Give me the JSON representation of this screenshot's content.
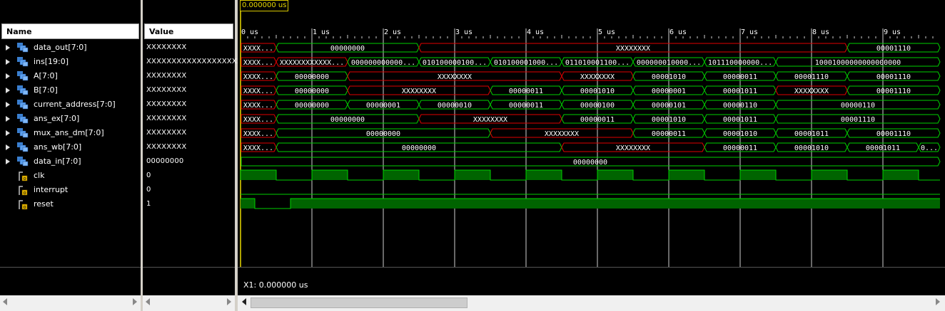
{
  "cursor_time": "0.000000 us",
  "headers": {
    "name": "Name",
    "value": "Value"
  },
  "time_ticks": [
    "0 us",
    "1 us",
    "2 us",
    "3 us",
    "4 us",
    "5 us",
    "6 us",
    "7 us",
    "8 us",
    "9 us"
  ],
  "cursor_readout": "X1: 0.000000 us",
  "colors": {
    "valid": "#00d000",
    "undefined": "#e00000",
    "cursor": "#e8d800",
    "clock_fill": "#006400"
  },
  "signals": [
    {
      "name": "data_out[7:0]",
      "value": "XXXXXXXX",
      "type": "bus",
      "segs": [
        {
          "t": 0,
          "e": 0.5,
          "v": "XXXXX...",
          "x": 1
        },
        {
          "t": 0.5,
          "e": 2.5,
          "v": "00000000",
          "x": 0
        },
        {
          "t": 2.5,
          "e": 8.5,
          "v": "XXXXXXXX",
          "x": 1
        },
        {
          "t": 8.5,
          "e": 9.8,
          "v": "00001110",
          "x": 0
        }
      ]
    },
    {
      "name": "ins[19:0]",
      "value": "XXXXXXXXXXXXXXXXXXXX",
      "type": "bus",
      "segs": [
        {
          "t": 0,
          "e": 0.5,
          "v": "XXXXX...",
          "x": 1
        },
        {
          "t": 0.5,
          "e": 1.5,
          "v": "XXXXXXXXXXXXX...",
          "x": 1
        },
        {
          "t": 1.5,
          "e": 2.5,
          "v": "0000000000000...",
          "x": 0
        },
        {
          "t": 2.5,
          "e": 3.5,
          "v": "0101000001000...",
          "x": 0
        },
        {
          "t": 3.5,
          "e": 4.5,
          "v": "0101000010000...",
          "x": 0
        },
        {
          "t": 4.5,
          "e": 5.5,
          "v": "0110100011000...",
          "x": 0
        },
        {
          "t": 5.5,
          "e": 6.5,
          "v": "0000000100000...",
          "x": 0
        },
        {
          "t": 6.5,
          "e": 7.5,
          "v": "1011100000001...",
          "x": 0
        },
        {
          "t": 7.5,
          "e": 9.8,
          "v": "10001000000000000000",
          "x": 0
        }
      ]
    },
    {
      "name": "A[7:0]",
      "value": "XXXXXXXX",
      "type": "bus",
      "segs": [
        {
          "t": 0,
          "e": 0.5,
          "v": "XXXXX...",
          "x": 1
        },
        {
          "t": 0.5,
          "e": 1.5,
          "v": "00000000",
          "x": 0
        },
        {
          "t": 1.5,
          "e": 4.5,
          "v": "XXXXXXXX",
          "x": 1
        },
        {
          "t": 4.5,
          "e": 5.5,
          "v": "XXXXXXXX",
          "x": 1
        },
        {
          "t": 5.5,
          "e": 6.5,
          "v": "00001010",
          "x": 0
        },
        {
          "t": 6.5,
          "e": 7.5,
          "v": "00000011",
          "x": 0
        },
        {
          "t": 7.5,
          "e": 8.5,
          "v": "00001110",
          "x": 0
        },
        {
          "t": 8.5,
          "e": 9.8,
          "v": "00001110",
          "x": 0
        }
      ]
    },
    {
      "name": "B[7:0]",
      "value": "XXXXXXXX",
      "type": "bus",
      "segs": [
        {
          "t": 0,
          "e": 0.5,
          "v": "XXXXX...",
          "x": 1
        },
        {
          "t": 0.5,
          "e": 1.5,
          "v": "00000000",
          "x": 0
        },
        {
          "t": 1.5,
          "e": 3.5,
          "v": "XXXXXXXX",
          "x": 1
        },
        {
          "t": 3.5,
          "e": 4.5,
          "v": "00000011",
          "x": 0
        },
        {
          "t": 4.5,
          "e": 5.5,
          "v": "00001010",
          "x": 0
        },
        {
          "t": 5.5,
          "e": 6.5,
          "v": "00000001",
          "x": 0
        },
        {
          "t": 6.5,
          "e": 7.5,
          "v": "00001011",
          "x": 0
        },
        {
          "t": 7.5,
          "e": 8.5,
          "v": "XXXXXXXX",
          "x": 1
        },
        {
          "t": 8.5,
          "e": 9.8,
          "v": "00001110",
          "x": 0
        }
      ]
    },
    {
      "name": "current_address[7:0]",
      "value": "XXXXXXXX",
      "type": "bus",
      "segs": [
        {
          "t": 0,
          "e": 0.5,
          "v": "XXXXX...",
          "x": 1
        },
        {
          "t": 0.5,
          "e": 1.5,
          "v": "00000000",
          "x": 0
        },
        {
          "t": 1.5,
          "e": 2.5,
          "v": "00000001",
          "x": 0
        },
        {
          "t": 2.5,
          "e": 3.5,
          "v": "00000010",
          "x": 0
        },
        {
          "t": 3.5,
          "e": 4.5,
          "v": "00000011",
          "x": 0
        },
        {
          "t": 4.5,
          "e": 5.5,
          "v": "00000100",
          "x": 0
        },
        {
          "t": 5.5,
          "e": 6.5,
          "v": "00000101",
          "x": 0
        },
        {
          "t": 6.5,
          "e": 7.5,
          "v": "00000110",
          "x": 0
        },
        {
          "t": 7.5,
          "e": 9.8,
          "v": "00000110",
          "x": 0
        }
      ]
    },
    {
      "name": "ans_ex[7:0]",
      "value": "XXXXXXXX",
      "type": "bus",
      "segs": [
        {
          "t": 0,
          "e": 0.5,
          "v": "XXXXX...",
          "x": 1
        },
        {
          "t": 0.5,
          "e": 2.5,
          "v": "00000000",
          "x": 0
        },
        {
          "t": 2.5,
          "e": 4.5,
          "v": "XXXXXXXX",
          "x": 1
        },
        {
          "t": 4.5,
          "e": 5.5,
          "v": "00000011",
          "x": 0
        },
        {
          "t": 5.5,
          "e": 6.5,
          "v": "00001010",
          "x": 0
        },
        {
          "t": 6.5,
          "e": 7.5,
          "v": "00001011",
          "x": 0
        },
        {
          "t": 7.5,
          "e": 9.8,
          "v": "00001110",
          "x": 0
        }
      ]
    },
    {
      "name": "mux_ans_dm[7:0]",
      "value": "XXXXXXXX",
      "type": "bus",
      "segs": [
        {
          "t": 0,
          "e": 0.5,
          "v": "XXXXX...",
          "x": 1
        },
        {
          "t": 0.5,
          "e": 3.5,
          "v": "00000000",
          "x": 0
        },
        {
          "t": 3.5,
          "e": 5.5,
          "v": "XXXXXXXX",
          "x": 1
        },
        {
          "t": 5.5,
          "e": 6.5,
          "v": "00000011",
          "x": 0
        },
        {
          "t": 6.5,
          "e": 7.5,
          "v": "00001010",
          "x": 0
        },
        {
          "t": 7.5,
          "e": 8.5,
          "v": "00001011",
          "x": 0
        },
        {
          "t": 8.5,
          "e": 9.8,
          "v": "00001110",
          "x": 0
        }
      ]
    },
    {
      "name": "ans_wb[7:0]",
      "value": "XXXXXXXX",
      "type": "bus",
      "segs": [
        {
          "t": 0,
          "e": 0.5,
          "v": "XXXXX...",
          "x": 1
        },
        {
          "t": 0.5,
          "e": 4.5,
          "v": "00000000",
          "x": 0
        },
        {
          "t": 4.5,
          "e": 6.5,
          "v": "XXXXXXXX",
          "x": 1
        },
        {
          "t": 6.5,
          "e": 7.5,
          "v": "00000011",
          "x": 0
        },
        {
          "t": 7.5,
          "e": 8.5,
          "v": "00001010",
          "x": 0
        },
        {
          "t": 8.5,
          "e": 9.5,
          "v": "00001011",
          "x": 0
        },
        {
          "t": 9.5,
          "e": 9.8,
          "v": "00...",
          "x": 0
        }
      ]
    },
    {
      "name": "data_in[7:0]",
      "value": "00000000",
      "type": "bus",
      "segs": [
        {
          "t": 0,
          "e": 9.8,
          "v": "00000000",
          "x": 0
        }
      ]
    },
    {
      "name": "clk",
      "value": "0",
      "type": "bit",
      "edges": [
        0,
        0.5,
        1,
        1.5,
        2,
        2.5,
        3,
        3.5,
        4,
        4.5,
        5,
        5.5,
        6,
        6.5,
        7,
        7.5,
        8,
        8.5,
        9,
        9.5
      ],
      "init": 0
    },
    {
      "name": "interrupt",
      "value": "0",
      "type": "bit",
      "edges": [],
      "init": 0
    },
    {
      "name": "reset",
      "value": "1",
      "type": "bit",
      "edges": [
        0.2,
        0.7
      ],
      "init": 1
    }
  ]
}
